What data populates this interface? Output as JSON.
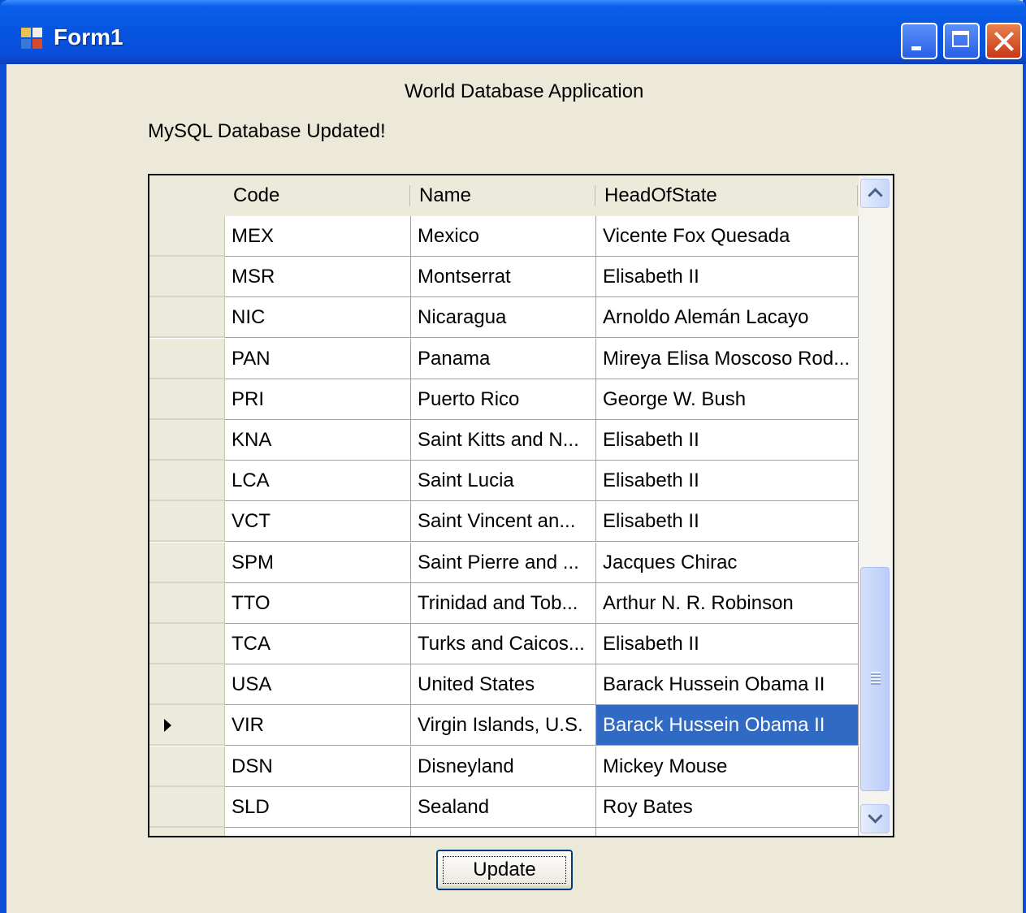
{
  "window": {
    "title": "Form1"
  },
  "labels": {
    "app_title": "World Database Application",
    "status": "MySQL Database Updated!"
  },
  "grid": {
    "columns": [
      "Code",
      "Name",
      "HeadOfState"
    ],
    "rows": [
      [
        "MEX",
        "Mexico",
        "Vicente Fox Quesada"
      ],
      [
        "MSR",
        "Montserrat",
        "Elisabeth II"
      ],
      [
        "NIC",
        "Nicaragua",
        "Arnoldo Alemán Lacayo"
      ],
      [
        "PAN",
        "Panama",
        "Mireya Elisa Moscoso Rod..."
      ],
      [
        "PRI",
        "Puerto Rico",
        "George W. Bush"
      ],
      [
        "KNA",
        "Saint Kitts and N...",
        "Elisabeth II"
      ],
      [
        "LCA",
        "Saint Lucia",
        "Elisabeth II"
      ],
      [
        "VCT",
        "Saint Vincent an...",
        "Elisabeth II"
      ],
      [
        "SPM",
        "Saint Pierre and ...",
        "Jacques Chirac"
      ],
      [
        "TTO",
        "Trinidad and Tob...",
        "Arthur N. R. Robinson"
      ],
      [
        "TCA",
        "Turks and Caicos...",
        "Elisabeth II"
      ],
      [
        "USA",
        "United States",
        "Barack Hussein Obama II"
      ],
      [
        "VIR",
        "Virgin Islands, U.S.",
        "Barack Hussein Obama II"
      ],
      [
        "DSN",
        "Disneyland",
        "Mickey Mouse"
      ],
      [
        "SLD",
        "Sealand",
        "Roy Bates"
      ]
    ],
    "current_row": 12,
    "selected_cell": {
      "row": 12,
      "col": 2
    },
    "selection_color": "#316AC5"
  },
  "buttons": {
    "update": "Update"
  },
  "icons": {
    "app": "form-app-icon",
    "minimize": "minimize-icon",
    "maximize": "maximize-icon",
    "close": "close-icon"
  }
}
